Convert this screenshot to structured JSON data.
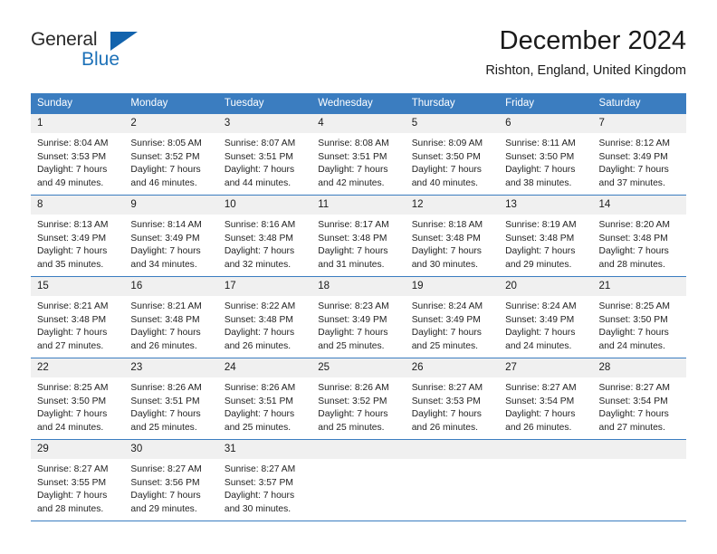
{
  "logo": {
    "word_top": "General",
    "word_bottom": "Blue",
    "triangle_icon": "triangle-icon",
    "color_dark": "#2a2a2a",
    "color_blue": "#1d71b8"
  },
  "header": {
    "title": "December 2024",
    "subtitle": "Rishton, England, United Kingdom"
  },
  "theme": {
    "header_blue": "#3b7dc0",
    "day_band_gray": "#f0f0f0",
    "text": "#232323"
  },
  "calendar": {
    "weekday_headers": [
      "Sunday",
      "Monday",
      "Tuesday",
      "Wednesday",
      "Thursday",
      "Friday",
      "Saturday"
    ],
    "weeks": [
      [
        {
          "day": "1",
          "sunrise": "Sunrise: 8:04 AM",
          "sunset": "Sunset: 3:53 PM",
          "daylight_line1": "Daylight: 7 hours",
          "daylight_line2": "and 49 minutes."
        },
        {
          "day": "2",
          "sunrise": "Sunrise: 8:05 AM",
          "sunset": "Sunset: 3:52 PM",
          "daylight_line1": "Daylight: 7 hours",
          "daylight_line2": "and 46 minutes."
        },
        {
          "day": "3",
          "sunrise": "Sunrise: 8:07 AM",
          "sunset": "Sunset: 3:51 PM",
          "daylight_line1": "Daylight: 7 hours",
          "daylight_line2": "and 44 minutes."
        },
        {
          "day": "4",
          "sunrise": "Sunrise: 8:08 AM",
          "sunset": "Sunset: 3:51 PM",
          "daylight_line1": "Daylight: 7 hours",
          "daylight_line2": "and 42 minutes."
        },
        {
          "day": "5",
          "sunrise": "Sunrise: 8:09 AM",
          "sunset": "Sunset: 3:50 PM",
          "daylight_line1": "Daylight: 7 hours",
          "daylight_line2": "and 40 minutes."
        },
        {
          "day": "6",
          "sunrise": "Sunrise: 8:11 AM",
          "sunset": "Sunset: 3:50 PM",
          "daylight_line1": "Daylight: 7 hours",
          "daylight_line2": "and 38 minutes."
        },
        {
          "day": "7",
          "sunrise": "Sunrise: 8:12 AM",
          "sunset": "Sunset: 3:49 PM",
          "daylight_line1": "Daylight: 7 hours",
          "daylight_line2": "and 37 minutes."
        }
      ],
      [
        {
          "day": "8",
          "sunrise": "Sunrise: 8:13 AM",
          "sunset": "Sunset: 3:49 PM",
          "daylight_line1": "Daylight: 7 hours",
          "daylight_line2": "and 35 minutes."
        },
        {
          "day": "9",
          "sunrise": "Sunrise: 8:14 AM",
          "sunset": "Sunset: 3:49 PM",
          "daylight_line1": "Daylight: 7 hours",
          "daylight_line2": "and 34 minutes."
        },
        {
          "day": "10",
          "sunrise": "Sunrise: 8:16 AM",
          "sunset": "Sunset: 3:48 PM",
          "daylight_line1": "Daylight: 7 hours",
          "daylight_line2": "and 32 minutes."
        },
        {
          "day": "11",
          "sunrise": "Sunrise: 8:17 AM",
          "sunset": "Sunset: 3:48 PM",
          "daylight_line1": "Daylight: 7 hours",
          "daylight_line2": "and 31 minutes."
        },
        {
          "day": "12",
          "sunrise": "Sunrise: 8:18 AM",
          "sunset": "Sunset: 3:48 PM",
          "daylight_line1": "Daylight: 7 hours",
          "daylight_line2": "and 30 minutes."
        },
        {
          "day": "13",
          "sunrise": "Sunrise: 8:19 AM",
          "sunset": "Sunset: 3:48 PM",
          "daylight_line1": "Daylight: 7 hours",
          "daylight_line2": "and 29 minutes."
        },
        {
          "day": "14",
          "sunrise": "Sunrise: 8:20 AM",
          "sunset": "Sunset: 3:48 PM",
          "daylight_line1": "Daylight: 7 hours",
          "daylight_line2": "and 28 minutes."
        }
      ],
      [
        {
          "day": "15",
          "sunrise": "Sunrise: 8:21 AM",
          "sunset": "Sunset: 3:48 PM",
          "daylight_line1": "Daylight: 7 hours",
          "daylight_line2": "and 27 minutes."
        },
        {
          "day": "16",
          "sunrise": "Sunrise: 8:21 AM",
          "sunset": "Sunset: 3:48 PM",
          "daylight_line1": "Daylight: 7 hours",
          "daylight_line2": "and 26 minutes."
        },
        {
          "day": "17",
          "sunrise": "Sunrise: 8:22 AM",
          "sunset": "Sunset: 3:48 PM",
          "daylight_line1": "Daylight: 7 hours",
          "daylight_line2": "and 26 minutes."
        },
        {
          "day": "18",
          "sunrise": "Sunrise: 8:23 AM",
          "sunset": "Sunset: 3:49 PM",
          "daylight_line1": "Daylight: 7 hours",
          "daylight_line2": "and 25 minutes."
        },
        {
          "day": "19",
          "sunrise": "Sunrise: 8:24 AM",
          "sunset": "Sunset: 3:49 PM",
          "daylight_line1": "Daylight: 7 hours",
          "daylight_line2": "and 25 minutes."
        },
        {
          "day": "20",
          "sunrise": "Sunrise: 8:24 AM",
          "sunset": "Sunset: 3:49 PM",
          "daylight_line1": "Daylight: 7 hours",
          "daylight_line2": "and 24 minutes."
        },
        {
          "day": "21",
          "sunrise": "Sunrise: 8:25 AM",
          "sunset": "Sunset: 3:50 PM",
          "daylight_line1": "Daylight: 7 hours",
          "daylight_line2": "and 24 minutes."
        }
      ],
      [
        {
          "day": "22",
          "sunrise": "Sunrise: 8:25 AM",
          "sunset": "Sunset: 3:50 PM",
          "daylight_line1": "Daylight: 7 hours",
          "daylight_line2": "and 24 minutes."
        },
        {
          "day": "23",
          "sunrise": "Sunrise: 8:26 AM",
          "sunset": "Sunset: 3:51 PM",
          "daylight_line1": "Daylight: 7 hours",
          "daylight_line2": "and 25 minutes."
        },
        {
          "day": "24",
          "sunrise": "Sunrise: 8:26 AM",
          "sunset": "Sunset: 3:51 PM",
          "daylight_line1": "Daylight: 7 hours",
          "daylight_line2": "and 25 minutes."
        },
        {
          "day": "25",
          "sunrise": "Sunrise: 8:26 AM",
          "sunset": "Sunset: 3:52 PM",
          "daylight_line1": "Daylight: 7 hours",
          "daylight_line2": "and 25 minutes."
        },
        {
          "day": "26",
          "sunrise": "Sunrise: 8:27 AM",
          "sunset": "Sunset: 3:53 PM",
          "daylight_line1": "Daylight: 7 hours",
          "daylight_line2": "and 26 minutes."
        },
        {
          "day": "27",
          "sunrise": "Sunrise: 8:27 AM",
          "sunset": "Sunset: 3:54 PM",
          "daylight_line1": "Daylight: 7 hours",
          "daylight_line2": "and 26 minutes."
        },
        {
          "day": "28",
          "sunrise": "Sunrise: 8:27 AM",
          "sunset": "Sunset: 3:54 PM",
          "daylight_line1": "Daylight: 7 hours",
          "daylight_line2": "and 27 minutes."
        }
      ],
      [
        {
          "day": "29",
          "sunrise": "Sunrise: 8:27 AM",
          "sunset": "Sunset: 3:55 PM",
          "daylight_line1": "Daylight: 7 hours",
          "daylight_line2": "and 28 minutes."
        },
        {
          "day": "30",
          "sunrise": "Sunrise: 8:27 AM",
          "sunset": "Sunset: 3:56 PM",
          "daylight_line1": "Daylight: 7 hours",
          "daylight_line2": "and 29 minutes."
        },
        {
          "day": "31",
          "sunrise": "Sunrise: 8:27 AM",
          "sunset": "Sunset: 3:57 PM",
          "daylight_line1": "Daylight: 7 hours",
          "daylight_line2": "and 30 minutes."
        },
        {
          "day": "",
          "sunrise": "",
          "sunset": "",
          "daylight_line1": "",
          "daylight_line2": ""
        },
        {
          "day": "",
          "sunrise": "",
          "sunset": "",
          "daylight_line1": "",
          "daylight_line2": ""
        },
        {
          "day": "",
          "sunrise": "",
          "sunset": "",
          "daylight_line1": "",
          "daylight_line2": ""
        },
        {
          "day": "",
          "sunrise": "",
          "sunset": "",
          "daylight_line1": "",
          "daylight_line2": ""
        }
      ]
    ]
  }
}
